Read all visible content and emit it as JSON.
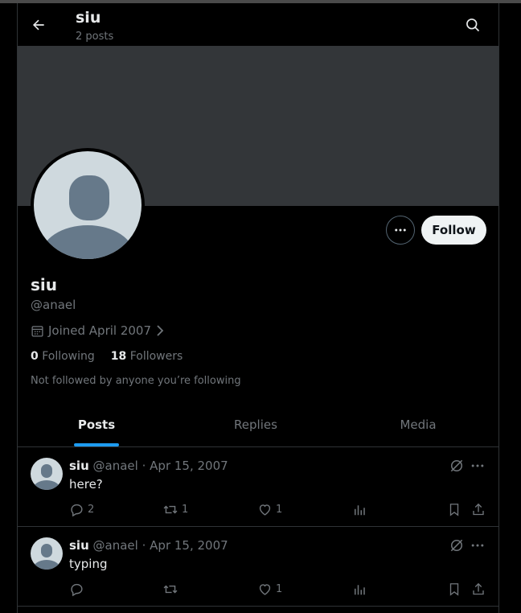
{
  "header": {
    "title": "siu",
    "subtitle": "2 posts"
  },
  "profile": {
    "name": "siu",
    "handle": "@anael",
    "joined": "Joined April 2007",
    "following_count": "0",
    "following_label": "Following",
    "followers_count": "18",
    "followers_label": "Followers",
    "followers_note": "Not followed by anyone you’re following",
    "follow_label": "Follow"
  },
  "tabs": [
    {
      "label": "Posts",
      "active": true
    },
    {
      "label": "Replies",
      "active": false
    },
    {
      "label": "Media",
      "active": false
    }
  ],
  "posts": [
    {
      "name": "siu",
      "handle": "@anael",
      "date": "Apr 15, 2007",
      "text": "here?",
      "replies": "2",
      "reposts": "1",
      "likes": "1"
    },
    {
      "name": "siu",
      "handle": "@anael",
      "date": "Apr 15, 2007",
      "text": "typing",
      "replies": "",
      "reposts": "",
      "likes": "1"
    }
  ],
  "colors": {
    "background": "#000000",
    "banner": "#333639",
    "accent": "#1d9bf0",
    "muted_text": "#71767b",
    "primary_text": "#e7e9ea"
  }
}
